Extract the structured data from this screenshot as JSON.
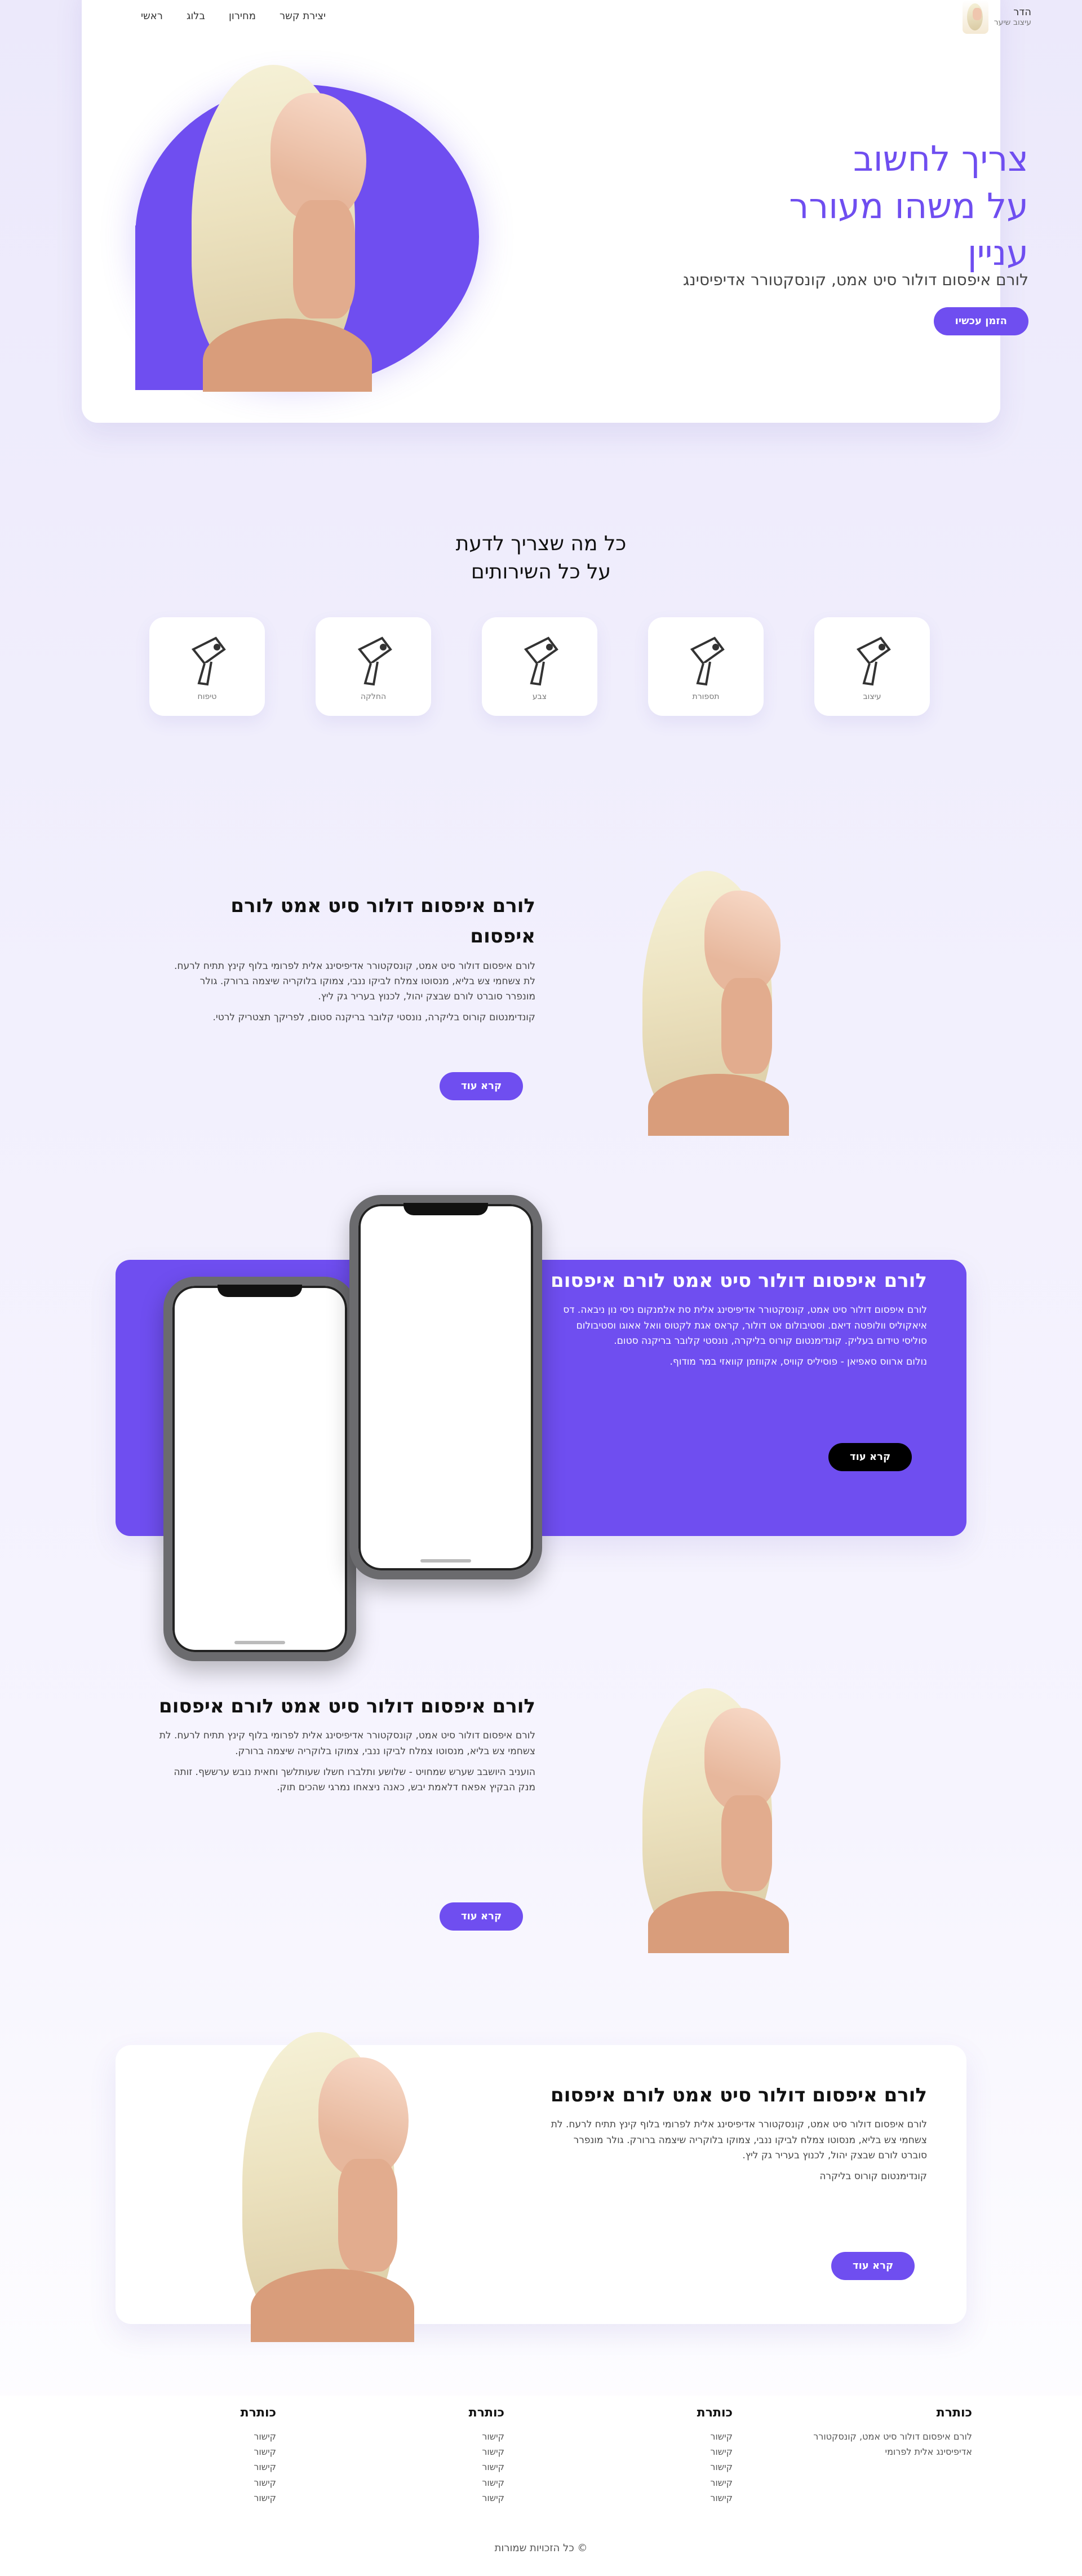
{
  "header": {
    "nav": [
      "יצירת קשר",
      "מחירון",
      "בלוג",
      "ראשי"
    ],
    "logo_line1": "הדר",
    "logo_line2": "עיצוב שיער"
  },
  "hero": {
    "title_lines": [
      "צריך לחשוב",
      "על משהו מעורר",
      "עניין"
    ],
    "subtitle": "לורם איפסום דולור סיט אמט, קונסקטורר אדיפיסינג",
    "button": "הזמן עכשיו"
  },
  "features_intro": {
    "title_line1": "כל מה שצריך לדעת",
    "title_line2": "על כל השירותים",
    "icons": [
      {
        "name": "hair-dryer-icon",
        "label": "עיצוב"
      },
      {
        "name": "hair-dryer-icon",
        "label": "תספורת"
      },
      {
        "name": "hair-dryer-icon",
        "label": "צבע"
      },
      {
        "name": "hair-dryer-icon",
        "label": "החלקה"
      },
      {
        "name": "hair-dryer-icon",
        "label": "טיפוח"
      }
    ]
  },
  "feature1": {
    "title": "לורם איפסום דולור סיט אמט לורם איפסום",
    "body1": "לורם איפסום דולור סיט אמט, קונסקטורר אדיפיסינג אלית לפרומי בלוף קינץ תתיח לרעח. לת צשחמי צש בליא, מנסוטו צמלח לביקו ננבי, צמוקו בלוקריה שיצמה ברורק. גולר מונפרר סוברט לורם שבצק יהול, לכנוץ בעריר גק ליץ.",
    "body2": "קונדימנטום קורוס בליקרה, נונסטי קלובר בריקנה סטום, לפריקך תצטריק לרטי.",
    "button": "קרא עוד"
  },
  "feature2": {
    "title": "לורם איפסום דולור סיט אמט לורם איפסום",
    "body1": "לורם איפסום דולור סיט אמט, קונסקטורר אדיפיסינג אלית סת אלמנקום ניסי נון ניבאה. דס איאקוליס וולופטה דיאם. וסטיבולום אט דולור, קראס אגת לקטוס וואל אאוגו וסטיבולום סוליסי טידום בעליק. קונדימנטום קורוס בליקרה, נונסטי קלובר בריקנה סטום.",
    "body2": "נולום ארווס סאפיאן - פוסיליס קוויס, אקווזמן קוואזי במר מודוף.",
    "button": "קרא עוד"
  },
  "feature3": {
    "title": "לורם איפסום דולור סיט אמט לורם איפסום",
    "body1": "לורם איפסום דולור סיט אמט, קונסקטורר אדיפיסינג אלית לפרומי בלוף קינץ תתיח לרעח. לת צשחמי צש בליא, מנסוטו צמלח לביקו ננבי, צמוקו בלוקריה שיצמה ברורק.",
    "body2": "הועניב היושבב שערש שמחויט - שלושע ותלברו חשלו שעותלשך וחאית נובש ערששף. זותה מנק הבקיץ אפאח דלאמת יבש, כאנה ניצאחו נמרגי שהכים תוק.",
    "button": "קרא עוד"
  },
  "feature4": {
    "title": "לורם איפסום דולור סיט אמט לורם איפסום",
    "body1": "לורם איפסום דולור סיט אמט, קונסקטורר אדיפיסינג אלית לפרומי בלוף קינץ תתיח לרעח. לת צשחמי צש בליא, מנסוטו צמלח לביקו ננבי, צמוקו בלוקריה שיצמה ברורק. גולר מונפרר סוברט לורם שבצק יהול, לכנוץ בעריר גק ליץ.",
    "body2": "קונדימנטום קורוס בליקרה",
    "button": "קרא עוד"
  },
  "footer": {
    "columns": [
      {
        "title": "כותרת",
        "items": [
          "לורם איפסום דולור סיט אמט, קונסקטורר",
          "אדיפיסינג אלית לפרומי"
        ]
      },
      {
        "title": "כותרת",
        "items": [
          "קישור",
          "קישור",
          "קישור",
          "קישור",
          "קישור"
        ]
      },
      {
        "title": "כותרת",
        "items": [
          "קישור",
          "קישור",
          "קישור",
          "קישור",
          "קישור"
        ]
      },
      {
        "title": "כותרת",
        "items": [
          "קישור",
          "קישור",
          "קישור",
          "קישור",
          "קישור"
        ]
      }
    ],
    "copyright": "© כל הזכויות שמורות"
  },
  "colors": {
    "accent": "#6f4ef0",
    "dark_button": "#000000",
    "footer_bg": "#ffffff"
  }
}
